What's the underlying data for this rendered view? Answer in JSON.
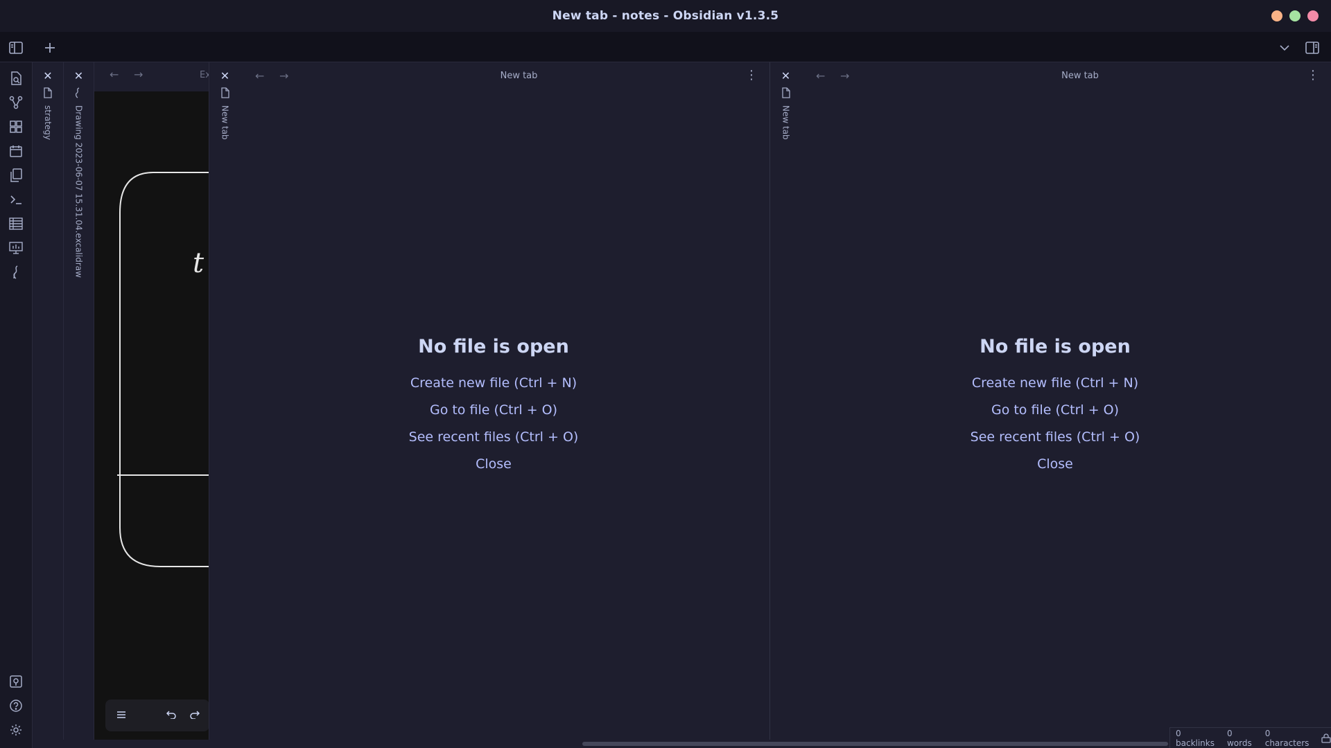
{
  "window": {
    "title": "New tab - notes - Obsidian v1.3.5",
    "controls": {
      "minimize_color": "#fab387",
      "maximize_color": "#a6e3a1",
      "close_color": "#f38ba8"
    }
  },
  "tabbar": {
    "left_icons": [
      "sidebar-toggle-icon",
      "new-tab-icon"
    ],
    "right_icons": [
      "tab-list-chevron-icon",
      "right-sidebar-toggle-icon"
    ]
  },
  "ribbon": {
    "top_icons": [
      "open-quick-switcher-icon",
      "graph-view-icon",
      "canvas-icon",
      "daily-note-icon",
      "templates-icon",
      "command-palette-icon",
      "table-icon",
      "slides-icon",
      "excalidraw-icon"
    ],
    "bottom_icons": [
      "vault-switcher-icon",
      "help-icon",
      "settings-icon"
    ]
  },
  "stacked_tabs": {
    "strategy": {
      "label": "strategy"
    },
    "drawing": {
      "label": "Drawing 2023-06-07 15.31.04.excalidraw"
    },
    "excalidraw_header": "Ex",
    "canvas_glyph": "t",
    "left_new_tab": {
      "label": "New tab"
    },
    "right_new_tab": {
      "label": "New tab"
    }
  },
  "panes": [
    {
      "tab_title": "New tab",
      "empty_state": {
        "heading": "No file is open",
        "create": "Create new file (Ctrl + N)",
        "goto": "Go to file (Ctrl + O)",
        "recent": "See recent files (Ctrl + O)",
        "close": "Close"
      }
    },
    {
      "tab_title": "New tab",
      "empty_state": {
        "heading": "No file is open",
        "create": "Create new file (Ctrl + N)",
        "goto": "Go to file (Ctrl + O)",
        "recent": "See recent files (Ctrl + O)",
        "close": "Close"
      }
    }
  ],
  "statusbar": {
    "backlinks": "0 backlinks",
    "words": "0 words",
    "characters": "0 characters"
  },
  "colors": {
    "accent": "#b4befe",
    "background": "#1e1e2e",
    "surface": "#181825"
  }
}
